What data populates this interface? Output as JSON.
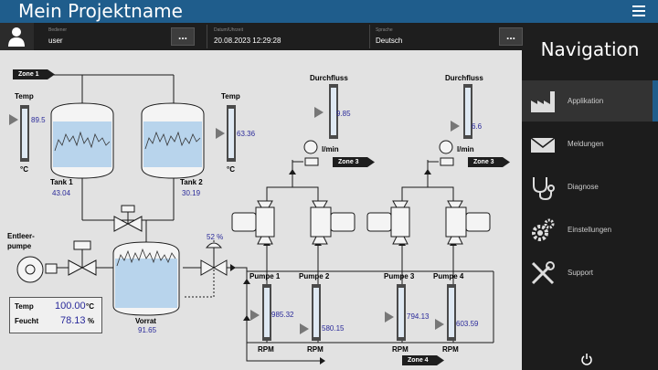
{
  "header": {
    "title": "Mein Projektname"
  },
  "infobar": {
    "user_label": "Bediener",
    "user_value": "user",
    "datetime_label": "Datum/Uhrzeit",
    "datetime_value": "20.08.2023 12:29:28",
    "lang_label": "Sprache",
    "lang_value": "Deutsch",
    "more_symbol": "..."
  },
  "nav": {
    "title": "Navigation",
    "items": [
      {
        "label": "Applikation",
        "icon": "factory-icon",
        "active": true
      },
      {
        "label": "Meldungen",
        "icon": "envelope-icon",
        "active": false
      },
      {
        "label": "Diagnose",
        "icon": "stethoscope-icon",
        "active": false
      },
      {
        "label": "Einstellungen",
        "icon": "gears-icon",
        "active": false
      },
      {
        "label": "Support",
        "icon": "tools-icon",
        "active": false
      }
    ]
  },
  "process": {
    "zones": {
      "z1": "Zone 1",
      "z3a": "Zone 3",
      "z3b": "Zone 3",
      "z4": "Zone 4"
    },
    "temp_left": {
      "label": "Temp",
      "value": "89.5",
      "unit": "°C"
    },
    "temp_right": {
      "label": "Temp",
      "value": "63.36",
      "unit": "°C"
    },
    "tank1": {
      "label": "Tank 1",
      "value": "43.04"
    },
    "tank2": {
      "label": "Tank 2",
      "value": "30.19"
    },
    "vorrat": {
      "label": "Vorrat",
      "value": "91.65"
    },
    "flow1": {
      "label": "Durchfluss",
      "value": "9.85",
      "unit": "l/min"
    },
    "flow2": {
      "label": "Durchfluss",
      "value": "6.6",
      "unit": "l/min"
    },
    "entleerpumpe": {
      "label_line1": "Entleer-",
      "label_line2": "pumpe"
    },
    "valve_percent": "52 %",
    "pumps": [
      {
        "label": "Pumpe 1",
        "value": "985.32",
        "unit": "RPM"
      },
      {
        "label": "Pumpe 2",
        "value": "580.15",
        "unit": "RPM"
      },
      {
        "label": "Pumpe 3",
        "value": "794.13",
        "unit": "RPM"
      },
      {
        "label": "Pumpe 4",
        "value": "603.59",
        "unit": "RPM"
      }
    ],
    "climate": {
      "temp_label": "Temp",
      "temp_value": "100.00",
      "temp_unit": "°C",
      "humid_label": "Feucht",
      "humid_value": "78.13",
      "humid_unit": "%"
    }
  },
  "colors": {
    "accent": "#1f5d8c",
    "value_text": "#2a2a9a",
    "tank_fill": "#b8d4ec"
  }
}
